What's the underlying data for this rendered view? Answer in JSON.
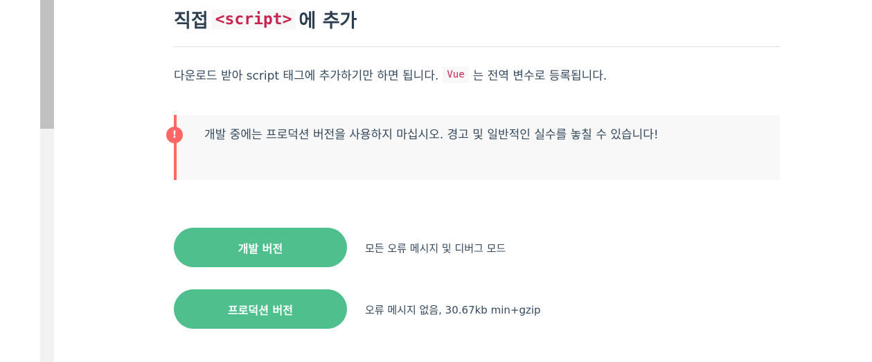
{
  "section": {
    "title_prefix": "직접",
    "title_code": "<script>",
    "title_suffix": "에 추가"
  },
  "intro": {
    "text_before": "다운로드 받아 script 태그에 추가하기만 하면 됩니다.",
    "code": "Vue",
    "text_after": "는 전역 변수로 등록됩니다."
  },
  "tip": {
    "icon": "!",
    "text": "개발 중에는 프로덕션 버전을 사용하지 마십시오. 경고 및 일반적인 실수를 놓칠 수 있습니다!"
  },
  "downloads": [
    {
      "label": "개발 버전",
      "description": "모든 오류 메시지 및 디버그 모드"
    },
    {
      "label": "프로덕션 버전",
      "description": "오류 메시지 없음, 30.67kb min+gzip"
    }
  ],
  "colors": {
    "accent": "#4fc08d",
    "warning": "#ff6666",
    "code_text": "#c7254e"
  }
}
